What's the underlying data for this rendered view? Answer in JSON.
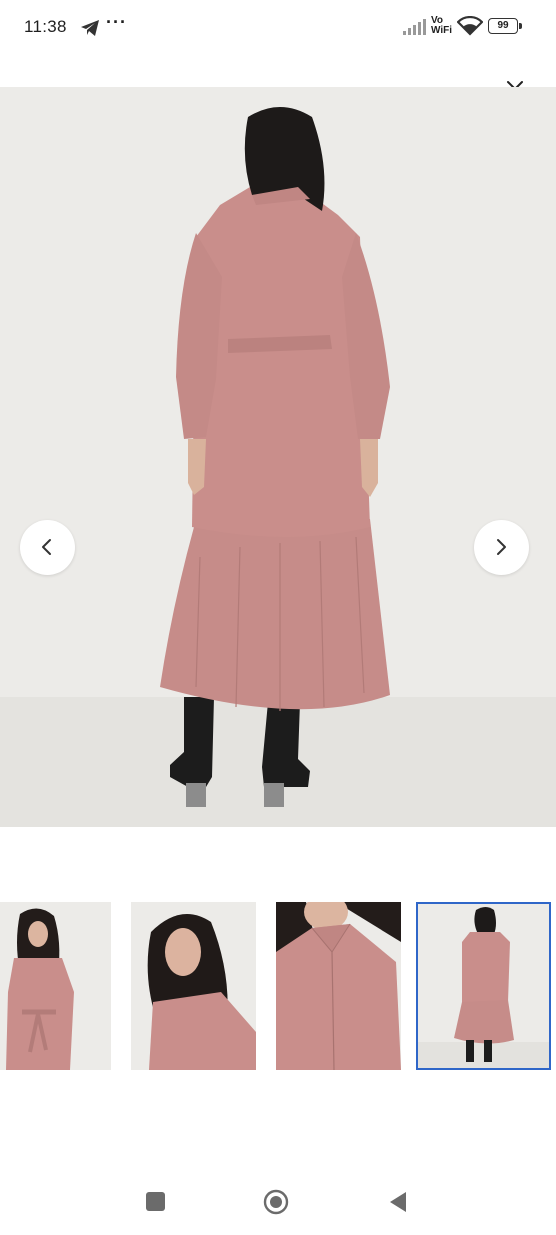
{
  "status_bar": {
    "time": "11:38",
    "more_dots": "···",
    "vowifi_line1": "Vo",
    "vowifi_line2": "WiFi",
    "battery": "99",
    "icons": [
      "telegram-icon",
      "signal-icon",
      "wifi-icon",
      "battery-icon"
    ]
  },
  "gallery": {
    "main_image": "model-back-view-pink-dress",
    "close_icon": "close-icon",
    "prev_icon": "chevron-left-icon",
    "next_icon": "chevron-right-icon",
    "thumbnails": [
      {
        "name": "front-view",
        "selected": false
      },
      {
        "name": "side-portrait",
        "selected": false
      },
      {
        "name": "collar-closeup",
        "selected": false
      },
      {
        "name": "back-view",
        "selected": true
      }
    ],
    "colors": {
      "dress": "#c98e8b",
      "background": "#ecebe8",
      "selected_border": "#2f66c8"
    }
  },
  "nav_bar": {
    "icons": [
      "recent-apps-icon",
      "home-icon",
      "back-icon"
    ]
  }
}
